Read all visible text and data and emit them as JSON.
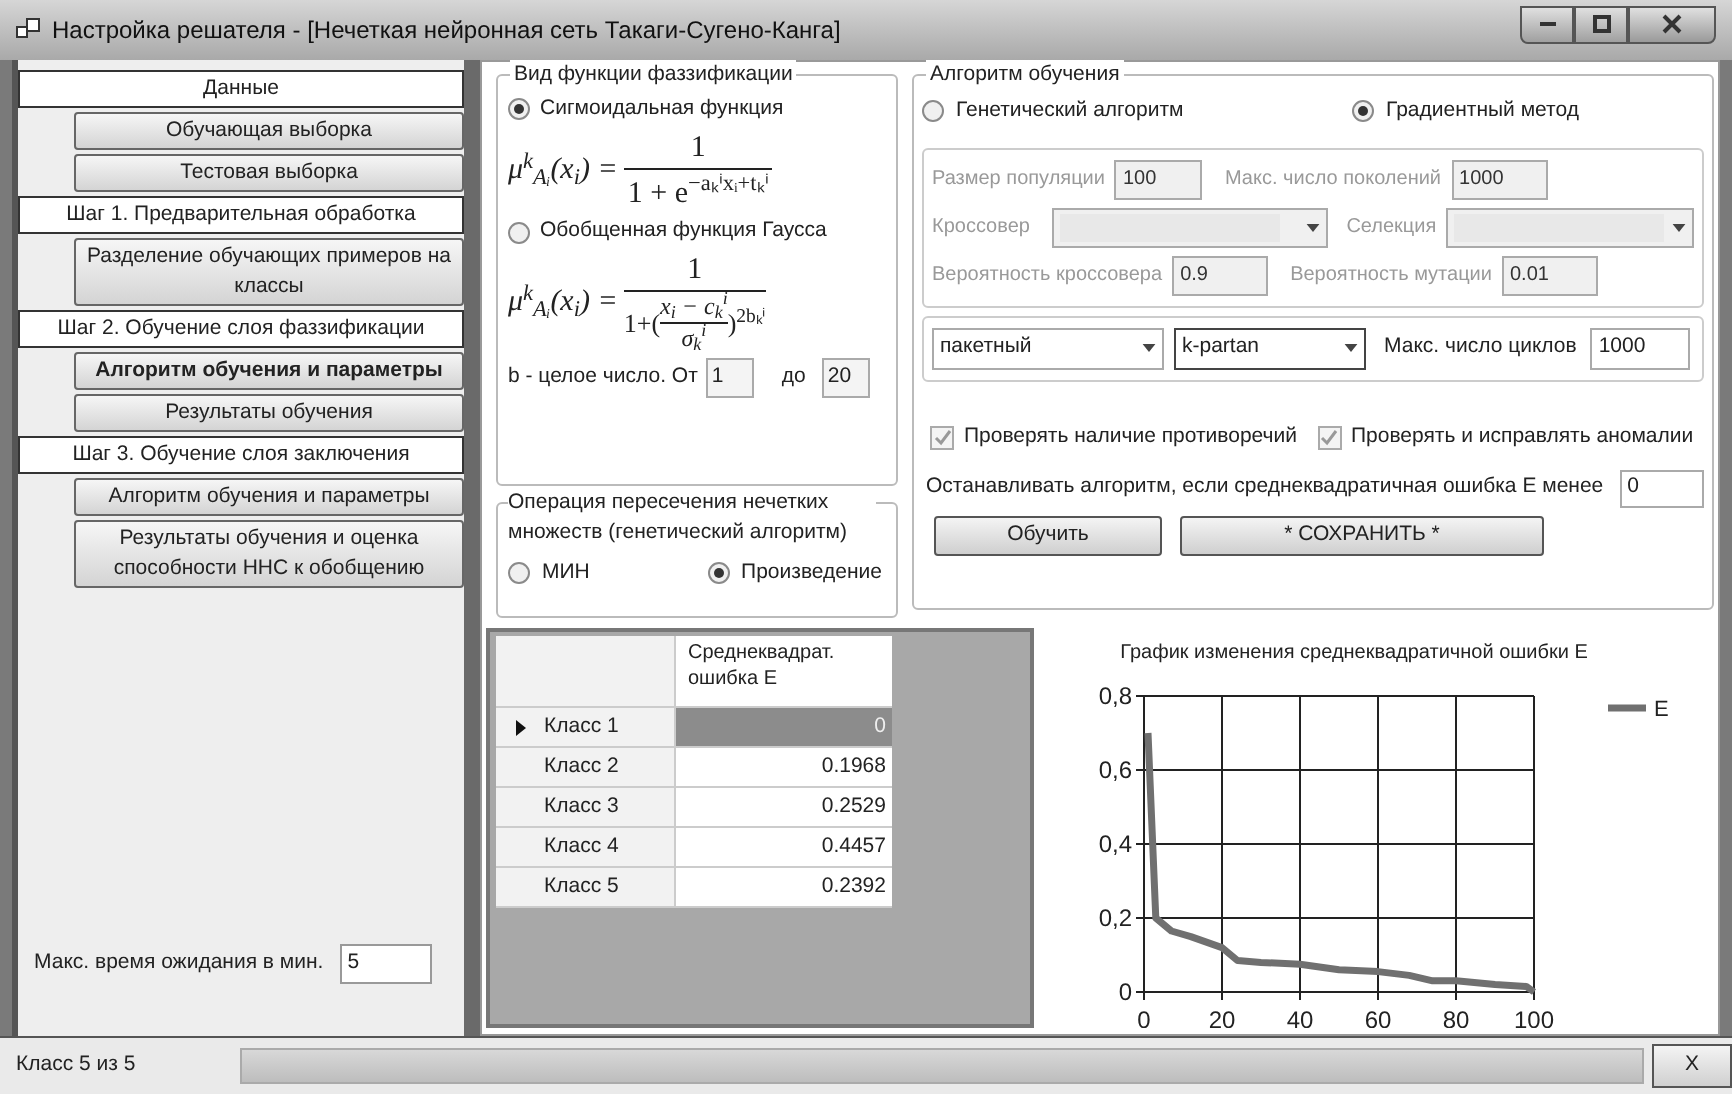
{
  "window": {
    "title": "Настройка решателя - [Нечеткая нейронная сеть Такаги-Сугено-Канга]"
  },
  "sidebar": {
    "sections": [
      {
        "header": "Данные",
        "items": [
          {
            "label": "Обучающая выборка",
            "selected": false
          },
          {
            "label": "Тестовая выборка",
            "selected": false
          }
        ]
      },
      {
        "header": "Шаг 1. Предварительная обработка",
        "items": [
          {
            "label": "Разделение обучающих примеров на классы",
            "selected": false
          }
        ]
      },
      {
        "header": "Шаг 2. Обучение слоя фаззификации",
        "items": [
          {
            "label": "Алгоритм обучения и параметры",
            "selected": true
          },
          {
            "label": "Результаты обучения",
            "selected": false
          }
        ]
      },
      {
        "header": "Шаг 3. Обучение слоя заключения",
        "items": [
          {
            "label": "Алгоритм обучения и параметры",
            "selected": false
          },
          {
            "label": "Результаты обучения и оценка способности ННС к обобщению",
            "selected": false
          }
        ]
      }
    ],
    "wait": {
      "label": "Макс. время ожидания в мин.",
      "value": "5"
    }
  },
  "fuzzification": {
    "title": "Вид функции фаззификации",
    "options": [
      {
        "label": "Сигмоидальная функция",
        "selected": true,
        "formula": {
          "kind": "sigmoid",
          "lhs": "μ$^{k}$$_{Aᵢ}$(x$_{i}$) =",
          "numerator": "1",
          "denominator": "1 + e$^{−aₖⁱxᵢ+tₖⁱ}$"
        }
      },
      {
        "label": "Обобщенная функция Гаусса",
        "selected": false,
        "formula": {
          "kind": "gauss",
          "lhs": "μ$^{k}$$_{Aᵢ}$(x$_{i}$) =",
          "numerator": "1",
          "prefix": "1+(",
          "inner_numerator": "x$_{i}$ − c$_{k}$$^{i}$",
          "inner_denominator": "σ$_{k}$$^{i}$",
          "suffix": ")$^{2bₖⁱ}$"
        }
      }
    ],
    "range": {
      "label": "b - целое число. От",
      "from": "1",
      "to_label": "до",
      "to": "20"
    }
  },
  "intersection": {
    "title": "Операция пересечения нечетких множеств (генетический алгоритм)",
    "options": [
      {
        "label": "МИН",
        "selected": false
      },
      {
        "label": "Произведение",
        "selected": true
      }
    ]
  },
  "algorithm": {
    "title": "Алгоритм обучения",
    "methods": [
      {
        "label": "Генетический алгоритм",
        "selected": false
      },
      {
        "label": "Градиентный метод",
        "selected": true
      }
    ],
    "genetic": {
      "disabled": true,
      "population_label": "Размер популяции",
      "population": "100",
      "generations_label": "Макс. число поколений",
      "generations": "1000",
      "crossover_label": "Кроссовер",
      "selection_label": "Селекция",
      "crossover_prob_label": "Вероятность кроссовера",
      "crossover_prob": "0.9",
      "mutation_prob_label": "Вероятность мутации",
      "mutation_prob": "0.01"
    },
    "gradient": {
      "mode": "пакетный",
      "method": "k-partan",
      "cycles_label": "Макс. число циклов",
      "cycles": "1000"
    },
    "checks": [
      {
        "label": "Проверять наличие противоречий",
        "checked": true,
        "disabled": true
      },
      {
        "label": "Проверять и исправлять аномалии",
        "checked": true,
        "disabled": true
      }
    ],
    "stop": {
      "label": "Останавливать алгоритм, если среднеквадратичная ошибка Е менее",
      "value": "0"
    },
    "buttons": [
      "Обучить",
      "* СОХРАНИТЬ *"
    ]
  },
  "grid": {
    "column": "Среднеквадрат. ошибка Е",
    "rows": [
      {
        "label": "Класс 1",
        "value": "0",
        "selected": true
      },
      {
        "label": "Класс 2",
        "value": "0.1968",
        "selected": false
      },
      {
        "label": "Класс 3",
        "value": "0.2529",
        "selected": false
      },
      {
        "label": "Класс 4",
        "value": "0.4457",
        "selected": false
      },
      {
        "label": "Класс 5",
        "value": "0.2392",
        "selected": false
      }
    ]
  },
  "chart": {
    "chart_data": {
      "type": "line",
      "title": "График изменения среднеквадратичной ошибки Е",
      "x": [
        1,
        3,
        7,
        12,
        20,
        24,
        30,
        40,
        50,
        60,
        68,
        74,
        80,
        90,
        98,
        100
      ],
      "series": [
        {
          "name": "E",
          "color": "#707070",
          "values": [
            0.7,
            0.2,
            0.165,
            0.15,
            0.12,
            0.085,
            0.08,
            0.075,
            0.06,
            0.055,
            0.045,
            0.03,
            0.03,
            0.02,
            0.015,
            0.0
          ]
        }
      ],
      "grid": true,
      "xlim": [
        0,
        100
      ],
      "ylim": [
        0,
        0.8
      ],
      "xticks": [
        0,
        20,
        40,
        60,
        80,
        100
      ],
      "yticks": [
        {
          "value": 0,
          "label": "0"
        },
        {
          "value": 0.2,
          "label": "0,2"
        },
        {
          "value": 0.4,
          "label": "0,4"
        },
        {
          "value": 0.6,
          "label": "0,6"
        },
        {
          "value": 0.8,
          "label": "0,8"
        }
      ]
    }
  },
  "status_bar": {
    "text": "Класс 5 из 5",
    "progress": {
      "level": 1
    },
    "close": "X"
  }
}
